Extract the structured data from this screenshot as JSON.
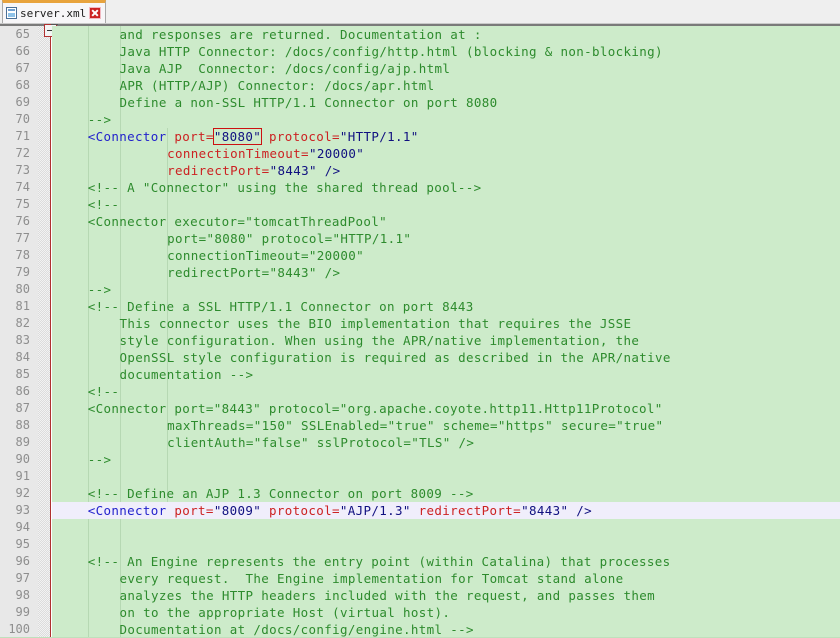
{
  "window": {
    "app_kind": "xml-source-editor"
  },
  "tabbar": {
    "tabs": [
      {
        "label": "server.xml",
        "icon": "xml-file-icon",
        "close_icon": "close-icon",
        "active": true
      }
    ]
  },
  "editor": {
    "first_line": 65,
    "last_line": 100,
    "current_line": 93,
    "search_hit": "\"8080\"",
    "fold_markers": [
      {
        "line": 70,
        "type": "tick"
      },
      {
        "line": 75,
        "type": "collapse-box"
      },
      {
        "line": 80,
        "type": "tick"
      },
      {
        "line": 81,
        "type": "collapse-box"
      },
      {
        "line": 86,
        "type": "collapse-box"
      },
      {
        "line": 90,
        "type": "tick"
      },
      {
        "line": 96,
        "type": "collapse-box"
      },
      {
        "line": 100,
        "type": "tick"
      }
    ],
    "lines": [
      {
        "n": 65,
        "indent": 8,
        "tokens": [
          {
            "c": "comment",
            "t": "and responses are returned. Documentation at :"
          }
        ]
      },
      {
        "n": 66,
        "indent": 8,
        "tokens": [
          {
            "c": "comment",
            "t": "Java HTTP Connector: /docs/config/http.html (blocking & non-blocking)"
          }
        ]
      },
      {
        "n": 67,
        "indent": 8,
        "tokens": [
          {
            "c": "comment",
            "t": "Java AJP  Connector: /docs/config/ajp.html"
          }
        ]
      },
      {
        "n": 68,
        "indent": 8,
        "tokens": [
          {
            "c": "comment",
            "t": "APR (HTTP/AJP) Connector: /docs/apr.html"
          }
        ]
      },
      {
        "n": 69,
        "indent": 8,
        "tokens": [
          {
            "c": "comment",
            "t": "Define a non-SSL HTTP/1.1 Connector on port 8080"
          }
        ]
      },
      {
        "n": 70,
        "indent": 4,
        "tokens": [
          {
            "c": "comment",
            "t": "-->"
          }
        ]
      },
      {
        "n": 71,
        "indent": 4,
        "tokens": [
          {
            "c": "tag",
            "t": "<Connector"
          },
          {
            "c": "plain",
            "t": " "
          },
          {
            "c": "attr",
            "t": "port"
          },
          {
            "c": "attr",
            "t": "="
          },
          {
            "c": "hit",
            "t": "\"8080\""
          },
          {
            "c": "plain",
            "t": " "
          },
          {
            "c": "attr",
            "t": "protocol"
          },
          {
            "c": "attr",
            "t": "="
          },
          {
            "c": "val",
            "t": "\"HTTP/1.1\""
          }
        ]
      },
      {
        "n": 72,
        "indent": 14,
        "tokens": [
          {
            "c": "attr",
            "t": "connectionTimeout"
          },
          {
            "c": "attr",
            "t": "="
          },
          {
            "c": "val",
            "t": "\"20000\""
          }
        ]
      },
      {
        "n": 73,
        "indent": 14,
        "tokens": [
          {
            "c": "attr",
            "t": "redirectPort"
          },
          {
            "c": "attr",
            "t": "="
          },
          {
            "c": "val",
            "t": "\"8443\""
          },
          {
            "c": "punct",
            "t": " />"
          }
        ]
      },
      {
        "n": 74,
        "indent": 4,
        "tokens": [
          {
            "c": "comment",
            "t": "<!-- A \"Connector\" using the shared thread pool-->"
          }
        ]
      },
      {
        "n": 75,
        "indent": 4,
        "tokens": [
          {
            "c": "comment",
            "t": "<!--"
          }
        ]
      },
      {
        "n": 76,
        "indent": 4,
        "tokens": [
          {
            "c": "comment",
            "t": "<Connector executor=\"tomcatThreadPool\""
          }
        ]
      },
      {
        "n": 77,
        "indent": 14,
        "tokens": [
          {
            "c": "comment",
            "t": "port=\"8080\" protocol=\"HTTP/1.1\""
          }
        ]
      },
      {
        "n": 78,
        "indent": 14,
        "tokens": [
          {
            "c": "comment",
            "t": "connectionTimeout=\"20000\""
          }
        ]
      },
      {
        "n": 79,
        "indent": 14,
        "tokens": [
          {
            "c": "comment",
            "t": "redirectPort=\"8443\" />"
          }
        ]
      },
      {
        "n": 80,
        "indent": 4,
        "tokens": [
          {
            "c": "comment",
            "t": "-->"
          }
        ]
      },
      {
        "n": 81,
        "indent": 4,
        "tokens": [
          {
            "c": "comment",
            "t": "<!-- Define a SSL HTTP/1.1 Connector on port 8443"
          }
        ]
      },
      {
        "n": 82,
        "indent": 8,
        "tokens": [
          {
            "c": "comment",
            "t": "This connector uses the BIO implementation that requires the JSSE"
          }
        ]
      },
      {
        "n": 83,
        "indent": 8,
        "tokens": [
          {
            "c": "comment",
            "t": "style configuration. When using the APR/native implementation, the"
          }
        ]
      },
      {
        "n": 84,
        "indent": 8,
        "tokens": [
          {
            "c": "comment",
            "t": "OpenSSL style configuration is required as described in the APR/native"
          }
        ]
      },
      {
        "n": 85,
        "indent": 8,
        "tokens": [
          {
            "c": "comment",
            "t": "documentation -->"
          }
        ]
      },
      {
        "n": 86,
        "indent": 4,
        "tokens": [
          {
            "c": "comment",
            "t": "<!--"
          }
        ]
      },
      {
        "n": 87,
        "indent": 4,
        "tokens": [
          {
            "c": "comment",
            "t": "<Connector port=\"8443\" protocol=\"org.apache.coyote.http11.Http11Protocol\""
          }
        ]
      },
      {
        "n": 88,
        "indent": 14,
        "tokens": [
          {
            "c": "comment",
            "t": "maxThreads=\"150\" SSLEnabled=\"true\" scheme=\"https\" secure=\"true\""
          }
        ]
      },
      {
        "n": 89,
        "indent": 14,
        "tokens": [
          {
            "c": "comment",
            "t": "clientAuth=\"false\" sslProtocol=\"TLS\" />"
          }
        ]
      },
      {
        "n": 90,
        "indent": 4,
        "tokens": [
          {
            "c": "comment",
            "t": "-->"
          }
        ]
      },
      {
        "n": 91,
        "indent": 0,
        "tokens": []
      },
      {
        "n": 92,
        "indent": 4,
        "tokens": [
          {
            "c": "comment",
            "t": "<!-- Define an AJP 1.3 Connector on port 8009 -->"
          }
        ]
      },
      {
        "n": 93,
        "indent": 4,
        "tokens": [
          {
            "c": "tag",
            "t": "<Connector"
          },
          {
            "c": "plain",
            "t": " "
          },
          {
            "c": "attr",
            "t": "port"
          },
          {
            "c": "attr",
            "t": "="
          },
          {
            "c": "val",
            "t": "\"8009\""
          },
          {
            "c": "plain",
            "t": " "
          },
          {
            "c": "attr",
            "t": "protocol"
          },
          {
            "c": "attr",
            "t": "="
          },
          {
            "c": "val",
            "t": "\"AJP/1.3\""
          },
          {
            "c": "plain",
            "t": " "
          },
          {
            "c": "attr",
            "t": "redirectPort"
          },
          {
            "c": "attr",
            "t": "="
          },
          {
            "c": "val",
            "t": "\"8443\""
          },
          {
            "c": "punct",
            "t": " />"
          }
        ]
      },
      {
        "n": 94,
        "indent": 0,
        "tokens": []
      },
      {
        "n": 95,
        "indent": 0,
        "tokens": []
      },
      {
        "n": 96,
        "indent": 4,
        "tokens": [
          {
            "c": "comment",
            "t": "<!-- An Engine represents the entry point (within Catalina) that processes"
          }
        ]
      },
      {
        "n": 97,
        "indent": 8,
        "tokens": [
          {
            "c": "comment",
            "t": "every request.  The Engine implementation for Tomcat stand alone"
          }
        ]
      },
      {
        "n": 98,
        "indent": 8,
        "tokens": [
          {
            "c": "comment",
            "t": "analyzes the HTTP headers included with the request, and passes them"
          }
        ]
      },
      {
        "n": 99,
        "indent": 8,
        "tokens": [
          {
            "c": "comment",
            "t": "on to the appropriate Host (virtual host)."
          }
        ]
      },
      {
        "n": 100,
        "indent": 8,
        "tokens": [
          {
            "c": "comment",
            "t": "Documentation at /docs/config/engine.html -->"
          }
        ]
      }
    ],
    "indent_guides": [
      {
        "col": 4,
        "from_line": 65,
        "to_line": 100
      },
      {
        "col": 8,
        "from_line": 65,
        "to_line": 100
      },
      {
        "col": 14,
        "from_line": 71,
        "to_line": 93
      }
    ],
    "colors": {
      "background": "#cdebca",
      "comment": "#2d8b2d",
      "tag": "#2222cc",
      "attribute": "#cc2222",
      "value": "#101080",
      "current_line": "#f0eefb",
      "search_box": "#cc1111",
      "gutter": "#e8e8e8",
      "line_number": "#8e8e8e",
      "fold_rail": "#b03030"
    }
  }
}
